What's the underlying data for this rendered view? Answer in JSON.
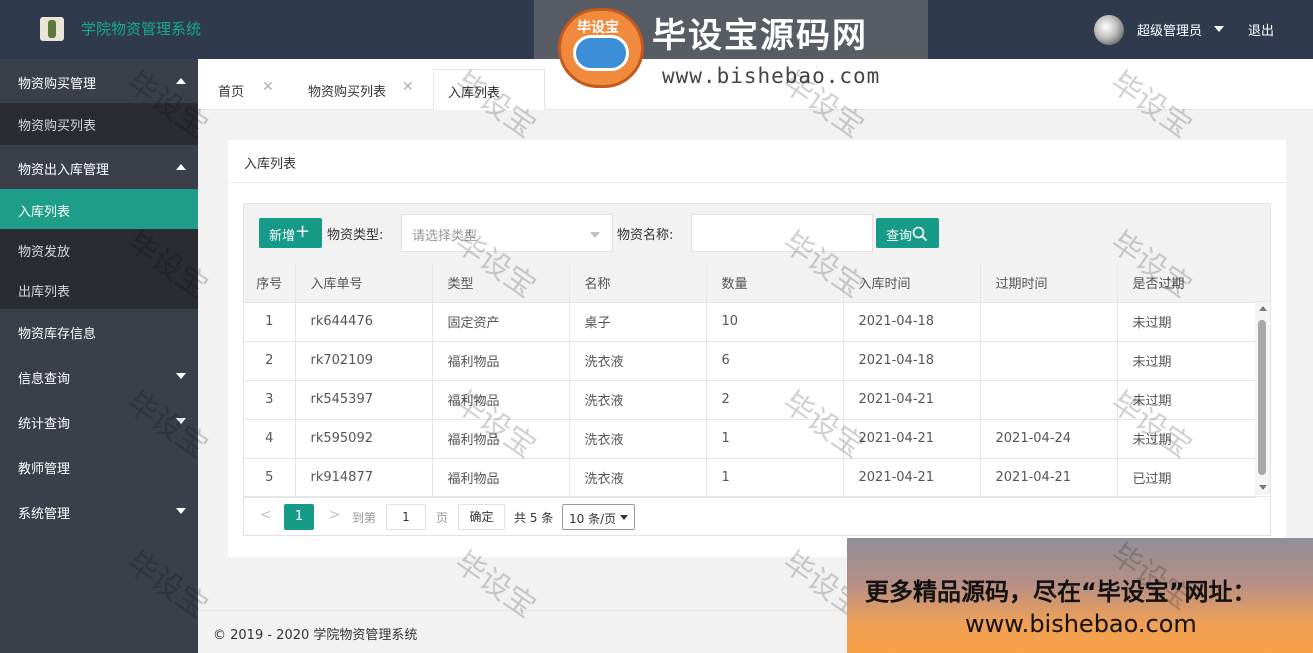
{
  "header": {
    "app_title": "学院物资管理系统",
    "user_name": "超级管理员",
    "logout_label": "退出"
  },
  "sidebar": {
    "groups": [
      {
        "label": "物资购买管理",
        "items": [
          {
            "label": "物资购买列表"
          }
        ]
      },
      {
        "label": "物资出入库管理",
        "items": [
          {
            "label": "入库列表"
          },
          {
            "label": "物资发放"
          },
          {
            "label": "出库列表"
          }
        ]
      }
    ],
    "singles": [
      {
        "label": "物资库存信息"
      },
      {
        "label": "信息查询"
      },
      {
        "label": "统计查询"
      },
      {
        "label": "教师管理"
      },
      {
        "label": "系统管理"
      }
    ]
  },
  "tabs": [
    {
      "label": "首页"
    },
    {
      "label": "物资购买列表"
    },
    {
      "label": "入库列表"
    }
  ],
  "card": {
    "title": "入库列表"
  },
  "toolbar": {
    "add_label": "新增",
    "type_label": "物资类型:",
    "type_placeholder": "请选择类型",
    "name_label": "物资名称:",
    "name_value": "",
    "search_label": "查询"
  },
  "table": {
    "columns": [
      "序号",
      "入库单号",
      "类型",
      "名称",
      "数量",
      "入库时间",
      "过期时间",
      "是否过期"
    ],
    "rows": [
      [
        "1",
        "rk644476",
        "固定资产",
        "桌子",
        "10",
        "2021-04-18",
        "",
        "未过期"
      ],
      [
        "2",
        "rk702109",
        "福利物品",
        "洗衣液",
        "6",
        "2021-04-18",
        "",
        "未过期"
      ],
      [
        "3",
        "rk545397",
        "福利物品",
        "洗衣液",
        "2",
        "2021-04-21",
        "",
        "未过期"
      ],
      [
        "4",
        "rk595092",
        "福利物品",
        "洗衣液",
        "1",
        "2021-04-21",
        "2021-04-24",
        "未过期"
      ],
      [
        "5",
        "rk914877",
        "福利物品",
        "洗衣液",
        "1",
        "2021-04-21",
        "2021-04-21",
        "已过期"
      ]
    ]
  },
  "pager": {
    "prev": "<",
    "current_page": "1",
    "next": ">",
    "goto_label": "到第",
    "goto_value": "1",
    "page_unit": "页",
    "confirm_label": "确定",
    "total_label": "共 5 条",
    "page_size_label": "10 条/页"
  },
  "footer": {
    "copyright": "© 2019 - 2020 学院物资管理系统"
  },
  "watermark": {
    "logo_text": "毕设宝",
    "brand": "毕设宝源码网",
    "url": "www.bishebao.com",
    "stamp": "毕设宝",
    "promo_line1": "更多精品源码，尽在“毕设宝”网址：",
    "promo_line2": "www.bishebao.com"
  },
  "colors": {
    "header_bg": "#2f3a4f",
    "sidebar_bg": "#3b3f4a",
    "accent": "#169b88",
    "title_green": "#19a894"
  }
}
